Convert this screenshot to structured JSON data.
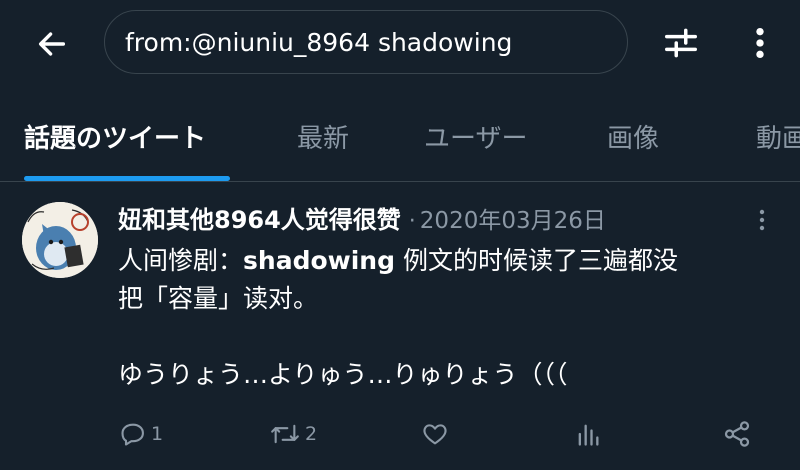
{
  "search": {
    "query": "from:@niuniu_8964 shadowing"
  },
  "tabs": [
    {
      "label": "話題のツイート"
    },
    {
      "label": "最新"
    },
    {
      "label": "ユーザー"
    },
    {
      "label": "画像"
    },
    {
      "label": "動画"
    }
  ],
  "tweet": {
    "author": "妞和其他8964人觉得很赞",
    "separator": "·",
    "date": "2020年03月26日",
    "text_line1_prefix": "人间惨剧：",
    "text_line1_bold": "shadowing",
    "text_line1_suffix": " 例文的时候读了三遍都没",
    "text_line2": "把「容量」读对。",
    "text_line4": "ゆうりょう…よりゅう…りゅりょう（（（",
    "replies": "1",
    "retweets": "2"
  },
  "colors": {
    "background": "#15202b",
    "accent": "#1d9bf0",
    "muted": "#8b98a5",
    "border": "#38444d"
  },
  "icons": [
    "back-arrow-icon",
    "filter-icon",
    "more-vertical-icon",
    "reply-icon",
    "retweet-icon",
    "like-icon",
    "analytics-icon",
    "share-icon"
  ]
}
